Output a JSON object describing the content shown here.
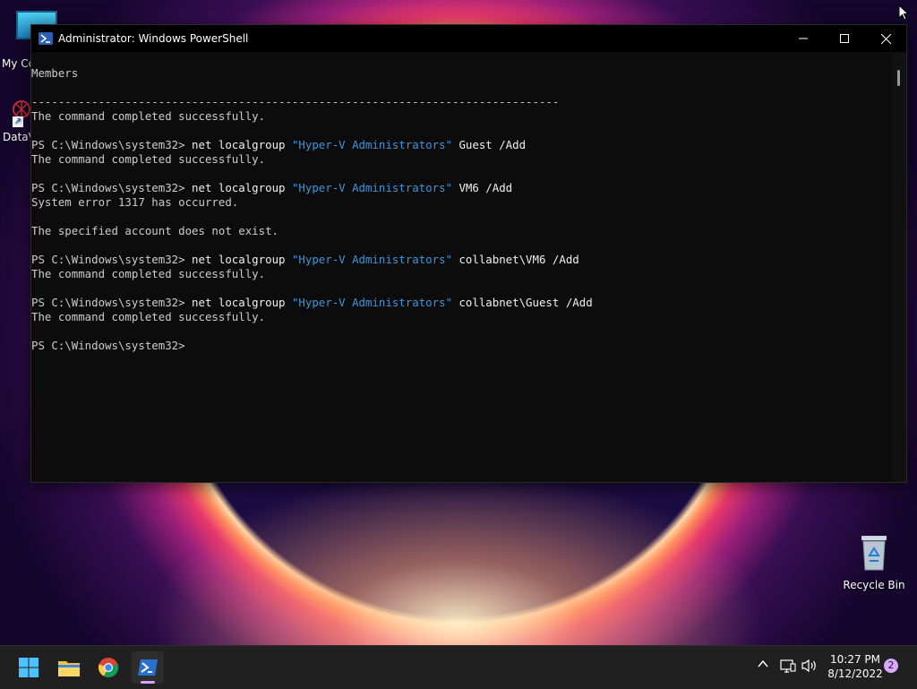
{
  "desktop": {
    "icons": [
      {
        "label": "My Co"
      },
      {
        "label": "DataV"
      },
      {
        "label": "Recycle Bin"
      }
    ]
  },
  "window": {
    "title": "Administrator: Windows PowerShell",
    "controls": {
      "minimize": "—",
      "maximize": "☐",
      "close": "✕"
    }
  },
  "console": {
    "lines": [
      {
        "text": "Members"
      },
      {
        "text": ""
      },
      {
        "text": "-------------------------------------------------------------------------------"
      },
      {
        "text": "The command completed successfully."
      },
      {
        "text": ""
      },
      {
        "prompt": "PS C:\\Windows\\system32> ",
        "cmd": "net localgroup ",
        "str": "\"Hyper-V Administrators\"",
        "rest": " Guest /Add"
      },
      {
        "text": "The command completed successfully."
      },
      {
        "text": ""
      },
      {
        "prompt": "PS C:\\Windows\\system32> ",
        "cmd": "net localgroup ",
        "str": "\"Hyper-V Administrators\"",
        "rest": " VM6 /Add"
      },
      {
        "text": "System error 1317 has occurred."
      },
      {
        "text": ""
      },
      {
        "text": "The specified account does not exist."
      },
      {
        "text": ""
      },
      {
        "prompt": "PS C:\\Windows\\system32> ",
        "cmd": "net localgroup ",
        "str": "\"Hyper-V Administrators\"",
        "rest": " collabnet\\VM6 /Add"
      },
      {
        "text": "The command completed successfully."
      },
      {
        "text": ""
      },
      {
        "prompt": "PS C:\\Windows\\system32> ",
        "cmd": "net localgroup ",
        "str": "\"Hyper-V Administrators\"",
        "rest": " collabnet\\Guest /Add"
      },
      {
        "text": "The command completed successfully."
      },
      {
        "text": ""
      },
      {
        "text": "PS C:\\Windows\\system32>"
      }
    ]
  },
  "taskbar": {
    "apps": [
      {
        "name": "start-icon"
      },
      {
        "name": "file-explorer-icon"
      },
      {
        "name": "chrome-icon"
      },
      {
        "name": "powershell-icon",
        "active": true
      }
    ],
    "tray": {
      "chevron": "^",
      "time": "10:27 PM",
      "date": "8/12/2022",
      "notifications": "2"
    }
  },
  "colors": {
    "console_bg": "#0c0c0c",
    "console_text": "#cccccc",
    "string_blue": "#3a96dd",
    "taskbar_bg": "#202020"
  }
}
